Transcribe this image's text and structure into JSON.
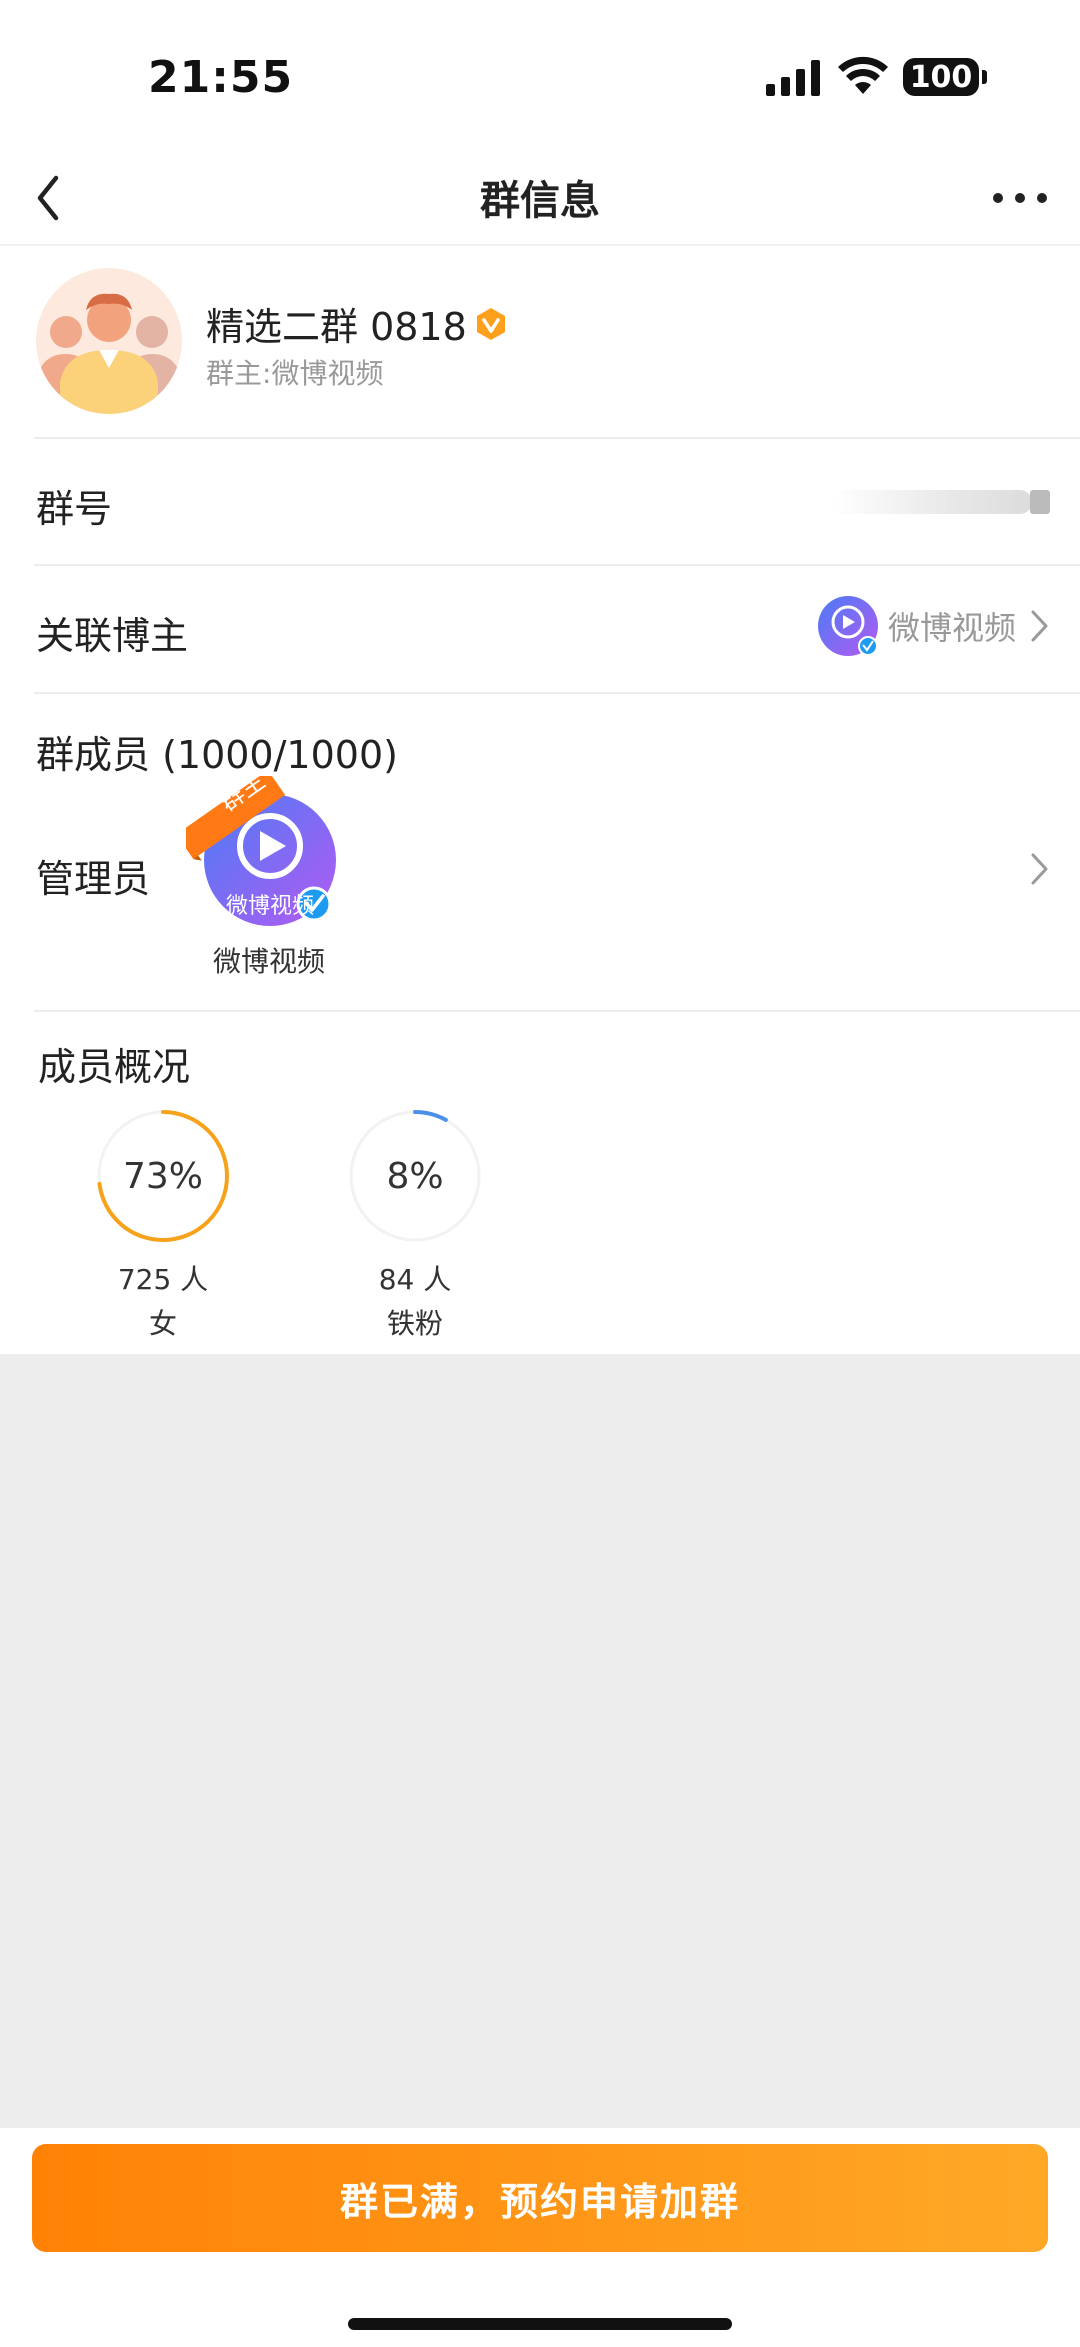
{
  "status": {
    "time": "21:55",
    "battery": "100"
  },
  "nav": {
    "title": "群信息"
  },
  "group": {
    "name": "精选二群 0818",
    "owner_label": "群主: ",
    "owner_name": "微博视频"
  },
  "rows": {
    "group_id_label": "群号",
    "linked_blogger_label": "关联博主",
    "linked_blogger_name": "微博视频",
    "members_label": "群成员 (1000/1000)",
    "admins_label": "管理员"
  },
  "admin": {
    "name": "微博视频",
    "badge": "群主",
    "avatar_text": "微博视频"
  },
  "stats": {
    "title": "成员概况",
    "items": [
      {
        "percent": "73%",
        "fraction": 0.73,
        "count": "725 人",
        "label": "女",
        "color": "#f7a21b"
      },
      {
        "percent": "8%",
        "fraction": 0.08,
        "count": "84 人",
        "label": "铁粉",
        "color": "#4a90e8"
      }
    ]
  },
  "footer": {
    "join_button": "群已满，预约申请加群"
  },
  "colors": {
    "accent_orange": "#ff8205",
    "accent_orange_light": "#ffa827",
    "verified_blue": "#1d9bf0"
  }
}
